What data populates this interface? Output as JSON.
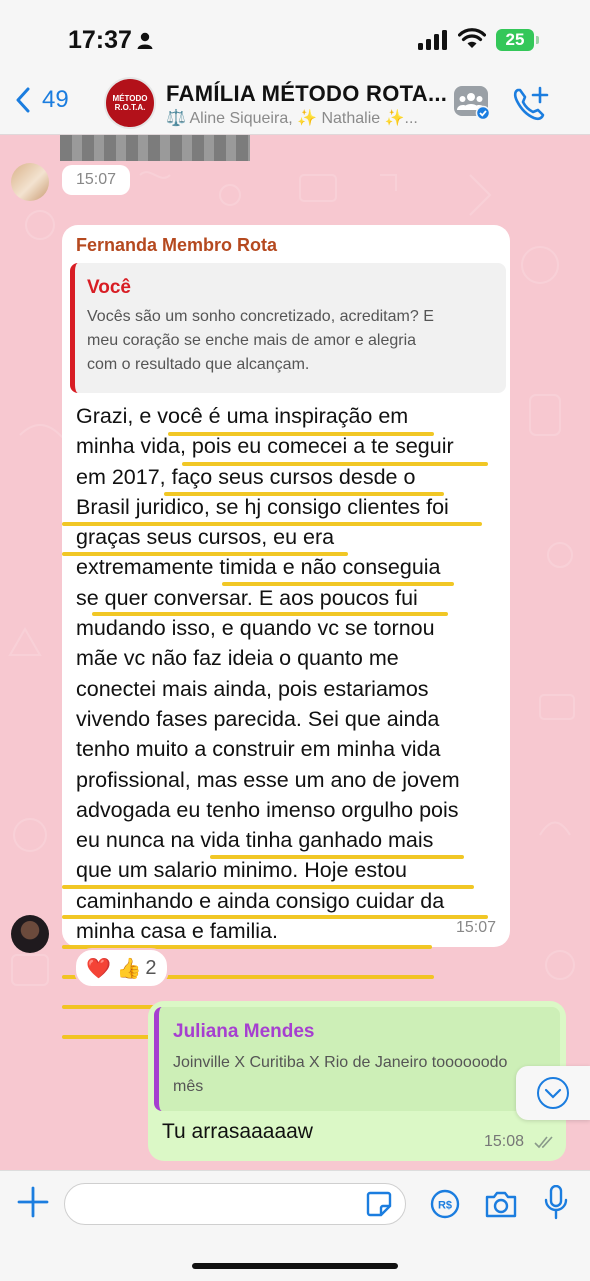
{
  "status_bar": {
    "time": "17:37",
    "battery": "25"
  },
  "header": {
    "back_count": "49",
    "group_avatar_lines": [
      "MÉTODO",
      "R.O.T.A."
    ],
    "title": "FAMÍLIA MÉTODO ROTA...",
    "subtitle": "⚖️ Aline Siqueira, ✨ Nathalie ✨..."
  },
  "chat": {
    "previous_time": "15:07",
    "message": {
      "sender": "Fernanda  Membro Rota",
      "quote_name": "Você",
      "quote_lines": [
        "Vocês são um sonho concretizado, acreditam? E",
        "meu coração se enche mais de amor e alegria",
        "com o resultado que alcançam."
      ],
      "lines": [
        "Grazi, e você é uma inspiração em",
        "minha vida, pois eu comecei a te seguir",
        "em 2017, faço seus cursos desde o",
        "Brasil juridico, se hj consigo clientes foi",
        "graças seus cursos, eu era",
        "extremamente timida e não conseguia",
        "se quer conversar. E aos poucos fui",
        "mudando isso, e quando vc se tornou",
        "mãe vc não faz ideia o quanto me",
        "conectei mais ainda, pois estariamos",
        "vivendo fases parecida. Sei que ainda",
        "tenho muito a construir em minha vida",
        "profissional, mas esse um ano de jovem",
        "advogada eu tenho imenso orgulho pois",
        "eu nunca na vida tinha ganhado mais",
        "que um salario minimo. Hoje estou",
        "caminhando e ainda consigo cuidar da",
        "minha casa e familia."
      ],
      "time": "15:07",
      "reactions": {
        "emojis": "❤️ 👍",
        "count": "2"
      }
    },
    "reply": {
      "quote_name": "Juliana Mendes",
      "quote_lines": [
        "Joinville X Curitiba X Rio de Janeiro toooooodo",
        "mês"
      ],
      "text": "Tu arrasaaaaaw",
      "time": "15:08"
    }
  },
  "colors": {
    "accent": "#1b7ddf",
    "chat_bg": "#f7c8d0",
    "highlight": "#f0c419"
  }
}
